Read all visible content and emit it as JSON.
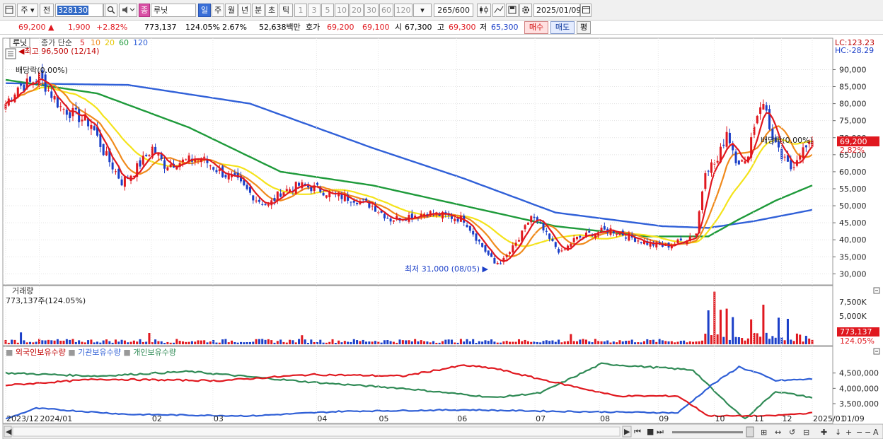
{
  "toolbar": {
    "market_label": "주",
    "prev_label": "전",
    "stock_code": "328130",
    "stock_name": "루닛",
    "name_badge": "종",
    "periods": [
      "일",
      "주",
      "월",
      "년",
      "분",
      "초",
      "틱"
    ],
    "selected_period": "일",
    "intervals": [
      "1",
      "3",
      "5",
      "10",
      "20",
      "30",
      "60",
      "120"
    ],
    "count": "265",
    "count_max": "/600",
    "date": "2025/01/09"
  },
  "quote": {
    "price": "69,200",
    "change": "1,900",
    "change_pct": "+2.82%",
    "volume": "773,137",
    "volume_ratio": "124.05%",
    "turnover": "2.67%",
    "amount": "52,638백만",
    "bid_label": "호가",
    "bid": "69,200",
    "ask": "69,100",
    "open_label": "시",
    "open": "67,300",
    "high_label": "고",
    "high": "69,300",
    "low_label": "저",
    "low": "65,300",
    "buy_label": "매수",
    "sell_label": "매도",
    "eval_label": "평"
  },
  "price_pane": {
    "stock_label": "루닛",
    "ma_label": "종가 단순",
    "ma_periods": [
      "5",
      "10",
      "20",
      "60",
      "120"
    ],
    "max_annotation": "최고 96,500 (12/14)",
    "min_annotation": "최저 31,000 (08/05)",
    "dividend_left": "배당락(0.00%)",
    "dividend_right": "배당락(0.00%)",
    "lc": "LC:123.23",
    "hc": "HC:-28.29",
    "y_ticks": [
      "90,000",
      "85,000",
      "80,000",
      "75,000",
      "70,000",
      "65,000",
      "60,000",
      "55,000",
      "50,000",
      "45,000",
      "40,000",
      "35,000",
      "30,000"
    ],
    "current_price": "69,200",
    "current_pct": "2.82%"
  },
  "volume_pane": {
    "title": "거래량",
    "value": "773,137주(124.05%)",
    "y_ticks": [
      "7,500K",
      "5,000K"
    ],
    "current": "773,137",
    "current_pct": "124.05%"
  },
  "holdings_pane": {
    "legend": [
      "외국인보유수량",
      "기관보유수량",
      "개인보유수량"
    ],
    "y_ticks": [
      "4,500,000",
      "4,000,000",
      "3,500,000"
    ]
  },
  "x_axis": {
    "labels": [
      "2023/12",
      "2024/01",
      "02",
      "03",
      "04",
      "05",
      "06",
      "07",
      "08",
      "09",
      "10",
      "11",
      "12",
      "2025/01"
    ],
    "right_label": "01/09"
  },
  "colors": {
    "up": "#e0181f",
    "down": "#1b3fc8",
    "ma5": "#e0181f",
    "ma10": "#f08a1c",
    "ma20": "#f4e31a",
    "ma60": "#1e9a3a",
    "ma120": "#3060d8",
    "foreign": "#e0181f",
    "institution": "#2f5fd6",
    "individual": "#2f8a55"
  },
  "chart_data": {
    "type": "candlestick",
    "y_range": [
      28000,
      93000
    ],
    "anchors": {
      "months": [
        "2023/12",
        "2024/01",
        "02",
        "03",
        "04",
        "05",
        "06",
        "07",
        "08",
        "09",
        "10",
        "11",
        "12",
        "2025/01"
      ],
      "close_path": [
        [
          0,
          80000
        ],
        [
          4,
          85000
        ],
        [
          8,
          86000
        ],
        [
          11,
          88000
        ],
        [
          14,
          84000
        ],
        [
          18,
          79000
        ],
        [
          24,
          76000
        ],
        [
          28,
          74000
        ],
        [
          32,
          66000
        ],
        [
          38,
          57000
        ],
        [
          42,
          60000
        ],
        [
          48,
          67000
        ],
        [
          52,
          62000
        ],
        [
          58,
          63000
        ],
        [
          64,
          64000
        ],
        [
          70,
          60000
        ],
        [
          76,
          57000
        ],
        [
          82,
          52000
        ],
        [
          86,
          50000
        ],
        [
          90,
          54000
        ],
        [
          96,
          56000
        ],
        [
          102,
          55000
        ],
        [
          108,
          53000
        ],
        [
          114,
          52000
        ],
        [
          120,
          50000
        ],
        [
          126,
          46000
        ],
        [
          132,
          47000
        ],
        [
          138,
          48000
        ],
        [
          144,
          47000
        ],
        [
          150,
          46000
        ],
        [
          156,
          38000
        ],
        [
          160,
          33000
        ],
        [
          163,
          34000
        ],
        [
          168,
          40000
        ],
        [
          172,
          47000
        ],
        [
          175,
          44000
        ],
        [
          178,
          40000
        ],
        [
          182,
          36000
        ],
        [
          186,
          40000
        ],
        [
          192,
          42000
        ],
        [
          198,
          43000
        ],
        [
          204,
          41000
        ],
        [
          210,
          39000
        ],
        [
          216,
          38000
        ],
        [
          222,
          40000
        ],
        [
          226,
          42000
        ],
        [
          229,
          61000
        ],
        [
          233,
          63000
        ],
        [
          236,
          72000
        ],
        [
          239,
          64000
        ],
        [
          242,
          62000
        ],
        [
          245,
          74000
        ],
        [
          247,
          80000
        ],
        [
          249,
          78000
        ],
        [
          251,
          69000
        ],
        [
          254,
          64000
        ],
        [
          257,
          61000
        ],
        [
          260,
          66000
        ],
        [
          263,
          67300
        ],
        [
          264,
          69200
        ]
      ],
      "ma60": [
        [
          0,
          87000
        ],
        [
          30,
          83000
        ],
        [
          60,
          73000
        ],
        [
          90,
          60000
        ],
        [
          120,
          56000
        ],
        [
          150,
          50000
        ],
        [
          180,
          44000
        ],
        [
          210,
          41000
        ],
        [
          230,
          41000
        ],
        [
          240,
          46000
        ],
        [
          252,
          51500
        ],
        [
          264,
          56000
        ]
      ],
      "ma120": [
        [
          0,
          86000
        ],
        [
          40,
          85500
        ],
        [
          80,
          80000
        ],
        [
          120,
          67000
        ],
        [
          150,
          58000
        ],
        [
          180,
          48000
        ],
        [
          215,
          44000
        ],
        [
          230,
          43500
        ],
        [
          245,
          45500
        ],
        [
          264,
          48800
        ]
      ]
    },
    "volume_spikes_k": [
      [
        5,
        2100
      ],
      [
        47,
        2000
      ],
      [
        97,
        1600
      ],
      [
        185,
        1800
      ],
      [
        230,
        6000
      ],
      [
        232,
        9300
      ],
      [
        234,
        6100
      ],
      [
        236,
        6300
      ],
      [
        238,
        4800
      ],
      [
        244,
        4400
      ],
      [
        248,
        7000
      ],
      [
        253,
        4700
      ],
      [
        256,
        4500
      ],
      [
        264,
        773
      ]
    ],
    "holdings": {
      "foreign": [
        [
          0,
          4100000
        ],
        [
          30,
          4300000
        ],
        [
          70,
          4250000
        ],
        [
          100,
          4450000
        ],
        [
          130,
          4400000
        ],
        [
          150,
          4750000
        ],
        [
          160,
          4650000
        ],
        [
          175,
          4300000
        ],
        [
          200,
          3750000
        ],
        [
          220,
          3750000
        ],
        [
          230,
          3100000
        ],
        [
          250,
          3100000
        ],
        [
          264,
          3200000
        ]
      ],
      "institution": [
        [
          0,
          3000000
        ],
        [
          10,
          3350000
        ],
        [
          40,
          3150000
        ],
        [
          80,
          3100000
        ],
        [
          110,
          3250000
        ],
        [
          150,
          3300000
        ],
        [
          180,
          3250000
        ],
        [
          220,
          3200000
        ],
        [
          231,
          4100000
        ],
        [
          240,
          4700000
        ],
        [
          246,
          4500000
        ],
        [
          252,
          4250000
        ],
        [
          264,
          4300000
        ]
      ],
      "individual": [
        [
          0,
          4500000
        ],
        [
          30,
          4400000
        ],
        [
          60,
          4550000
        ],
        [
          100,
          4200000
        ],
        [
          130,
          4000000
        ],
        [
          160,
          3700000
        ],
        [
          175,
          3850000
        ],
        [
          195,
          4800000
        ],
        [
          225,
          4600000
        ],
        [
          233,
          3800000
        ],
        [
          242,
          3000000
        ],
        [
          252,
          3900000
        ],
        [
          264,
          3700000
        ]
      ]
    }
  }
}
